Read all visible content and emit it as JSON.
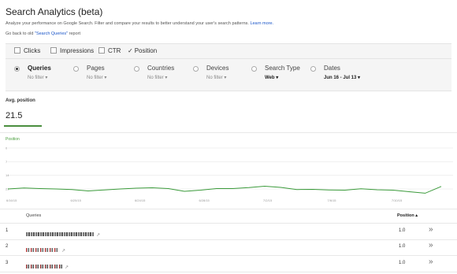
{
  "page": {
    "title": "Search Analytics (beta)",
    "subtitle": "Analyze your performance on Google Search. Filter and compare your results to better understand your user's search patterns.",
    "learn_more": "Learn more.",
    "goback_prefix": "Go back to old ",
    "goback_link": "\"Search Queries\"",
    "goback_suffix": " report"
  },
  "metrics": [
    {
      "label": "Clicks",
      "checked": false
    },
    {
      "label": "Impressions",
      "checked": false
    },
    {
      "label": "CTR",
      "checked": false
    },
    {
      "label": "Position",
      "checked": true
    }
  ],
  "dimensions": [
    {
      "label": "Queries",
      "sub": "No filter",
      "selected": true
    },
    {
      "label": "Pages",
      "sub": "No filter",
      "selected": false
    },
    {
      "label": "Countries",
      "sub": "No filter",
      "selected": false
    },
    {
      "label": "Devices",
      "sub": "No filter",
      "selected": false
    },
    {
      "label": "Search Type",
      "sub": "Web",
      "selected": false
    },
    {
      "label": "Dates",
      "sub": "Jun 16 - Jul 13",
      "selected": false
    }
  ],
  "metric_card": {
    "label": "Avg. position",
    "value": "21.5"
  },
  "chart": {
    "label": "Position",
    "y_ticks": [
      "0",
      "7",
      "14",
      "21"
    ],
    "x_ticks": [
      "6/16/15",
      "6/20/15",
      "6/24/15",
      "6/28/15",
      "7/2/15",
      "7/6/15",
      "7/10/15"
    ],
    "color": "#3a9a3a"
  },
  "chart_data": {
    "type": "line",
    "title": "",
    "xlabel": "",
    "ylabel": "Position",
    "ylim": [
      0,
      21
    ],
    "y_inverted": true,
    "x": [
      "6/16/15",
      "6/17/15",
      "6/18/15",
      "6/19/15",
      "6/20/15",
      "6/21/15",
      "6/22/15",
      "6/23/15",
      "6/24/15",
      "6/25/15",
      "6/26/15",
      "6/27/15",
      "6/28/15",
      "6/29/15",
      "6/30/15",
      "7/1/15",
      "7/2/15",
      "7/3/15",
      "7/4/15",
      "7/5/15",
      "7/6/15",
      "7/7/15",
      "7/8/15",
      "7/9/15",
      "7/10/15",
      "7/11/15",
      "7/12/15",
      "7/13/15"
    ],
    "series": [
      {
        "values": [
          21.0,
          20.5,
          20.8,
          21.0,
          21.3,
          22.0,
          21.5,
          21.0,
          20.6,
          20.4,
          20.8,
          22.2,
          21.6,
          20.8,
          20.8,
          20.3,
          19.6,
          20.2,
          21.3,
          21.2,
          21.5,
          21.6,
          20.9,
          21.4,
          21.6,
          22.4,
          23.2,
          19.7
        ]
      }
    ]
  },
  "table": {
    "col_query": "Queries",
    "col_position": "Position ▴",
    "rows": [
      {
        "num": "1",
        "position": "1.0",
        "arrow": "»"
      },
      {
        "num": "2",
        "position": "1.0",
        "arrow": "»"
      },
      {
        "num": "3",
        "position": "1.0",
        "arrow": "»"
      }
    ]
  }
}
